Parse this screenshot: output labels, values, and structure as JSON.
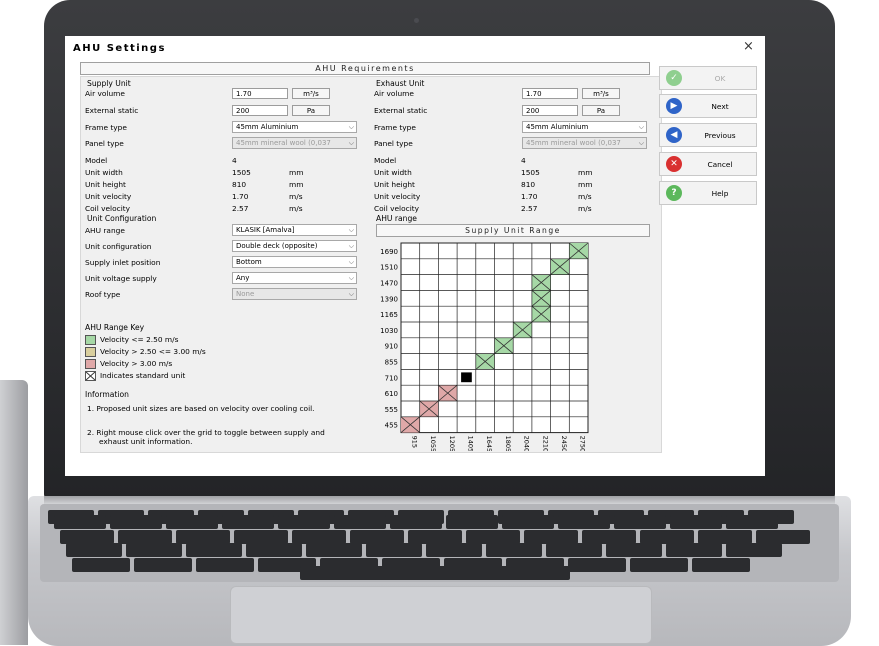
{
  "window": {
    "title": "AHU Settings",
    "close_glyph": "×",
    "section_title": "AHU Requirements"
  },
  "supply_unit": {
    "heading": "Supply Unit",
    "air_volume": {
      "label": "Air volume",
      "value": "1.70",
      "unit": "m³/s"
    },
    "external_static": {
      "label": "External static",
      "value": "200",
      "unit": "Pa"
    },
    "frame_type": {
      "label": "Frame type",
      "value": "45mm Aluminium"
    },
    "panel_type": {
      "label": "Panel type",
      "value": "45mm mineral wool (0,037"
    },
    "info_rows": [
      {
        "label": "Model",
        "value": "4",
        "unit": ""
      },
      {
        "label": "Unit width",
        "value": "1505",
        "unit": "mm"
      },
      {
        "label": "Unit height",
        "value": "810",
        "unit": "mm"
      },
      {
        "label": "Unit velocity",
        "value": "1.70",
        "unit": "m/s"
      },
      {
        "label": "Coil velocity",
        "value": "2.57",
        "unit": "m/s"
      }
    ]
  },
  "exhaust_unit": {
    "heading": "Exhaust Unit",
    "air_volume": {
      "label": "Air volume",
      "value": "1.70",
      "unit": "m³/s"
    },
    "external_static": {
      "label": "External static",
      "value": "200",
      "unit": "Pa"
    },
    "frame_type": {
      "label": "Frame type",
      "value": "45mm Aluminium"
    },
    "panel_type": {
      "label": "Panel type",
      "value": "45mm mineral wool (0,037"
    },
    "info_rows": [
      {
        "label": "Model",
        "value": "4",
        "unit": ""
      },
      {
        "label": "Unit width",
        "value": "1505",
        "unit": "mm"
      },
      {
        "label": "Unit height",
        "value": "810",
        "unit": "mm"
      },
      {
        "label": "Unit velocity",
        "value": "1.70",
        "unit": "m/s"
      },
      {
        "label": "Coil velocity",
        "value": "2.57",
        "unit": "m/s"
      }
    ]
  },
  "unit_configuration": {
    "heading": "Unit Configuration",
    "ahu_range": {
      "label": "AHU range",
      "value": "KLASIK [Amalva]"
    },
    "unit_configuration": {
      "label": "Unit configuration",
      "value": "Double deck (opposite)"
    },
    "supply_inlet_position": {
      "label": "Supply inlet position",
      "value": "Bottom"
    },
    "unit_voltage_supply": {
      "label": "Unit voltage supply",
      "value": "Any"
    },
    "roof_type": {
      "label": "Roof type",
      "value": "None"
    }
  },
  "range_key": {
    "heading": "AHU Range Key",
    "items": [
      {
        "label": "Velocity <= 2.50 m/s",
        "color": "#a6d8a6"
      },
      {
        "label": "Velocity > 2.50 <= 3.00 m/s",
        "color": "#d9cf9e"
      },
      {
        "label": "Velocity > 3.00 m/s",
        "color": "#dfa8a8"
      },
      {
        "label": "Indicates standard unit",
        "color": "#ffffff"
      }
    ]
  },
  "information": {
    "heading": "Information",
    "lines": [
      "1.  Proposed unit sizes are based on velocity over cooling coil.",
      "2.  Right mouse click over the grid to toggle between supply and",
      "exhaust unit information."
    ]
  },
  "ahu_range_panel": {
    "heading": "AHU range"
  },
  "buttons": {
    "ok": {
      "label": "OK",
      "icon": "check-icon"
    },
    "next": {
      "label": "Next",
      "icon": "arrow-right-icon"
    },
    "previous": {
      "label": "Previous",
      "icon": "arrow-left-icon"
    },
    "cancel": {
      "label": "Cancel",
      "icon": "close-icon"
    },
    "help": {
      "label": "Help",
      "icon": "question-icon"
    }
  },
  "colors": {
    "green": "#a6d8a6",
    "tan": "#d9cf9e",
    "red": "#dfa8a8",
    "ok_icon": "#8fcf8f",
    "nav_icon": "#2f64c8",
    "cancel_icon": "#d93030",
    "help_icon": "#5cb85c"
  },
  "chart_data": {
    "type": "heatmap",
    "title": "Supply Unit Range",
    "x_categories": [
      "915",
      "1055",
      "1205",
      "1405",
      "1645",
      "1805",
      "2040",
      "2210",
      "2450",
      "2750"
    ],
    "y_categories": [
      "1690",
      "1510",
      "1470",
      "1390",
      "1165",
      "1030",
      "910",
      "855",
      "710",
      "610",
      "555",
      "455"
    ],
    "cells": [
      {
        "x": "2750",
        "y": "1690",
        "velocity_class": "<= 2.50",
        "standard": true
      },
      {
        "x": "2450",
        "y": "1510",
        "velocity_class": "<= 2.50",
        "standard": true
      },
      {
        "x": "2210",
        "y": "1470",
        "velocity_class": "<= 2.50",
        "standard": true
      },
      {
        "x": "2210",
        "y": "1390",
        "velocity_class": "<= 2.50",
        "standard": true
      },
      {
        "x": "2210",
        "y": "1165",
        "velocity_class": "<= 2.50",
        "standard": true
      },
      {
        "x": "2040",
        "y": "1030",
        "velocity_class": "<= 2.50",
        "standard": true
      },
      {
        "x": "1805",
        "y": "910",
        "velocity_class": "<= 2.50",
        "standard": true
      },
      {
        "x": "1645",
        "y": "855",
        "velocity_class": "<= 2.50",
        "standard": true
      },
      {
        "x": "1405",
        "y": "710",
        "velocity_class": "selected",
        "standard": true
      },
      {
        "x": "1205",
        "y": "610",
        "velocity_class": "> 3.00",
        "standard": true
      },
      {
        "x": "1055",
        "y": "555",
        "velocity_class": "> 3.00",
        "standard": true
      },
      {
        "x": "915",
        "y": "455",
        "velocity_class": "> 3.00",
        "standard": true
      }
    ]
  }
}
